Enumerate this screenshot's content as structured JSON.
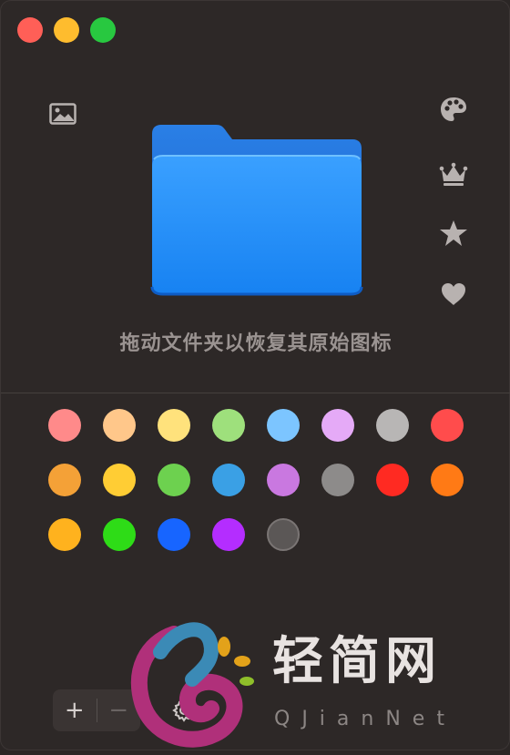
{
  "window": {
    "traffic_lights": [
      "close",
      "minimize",
      "maximize"
    ]
  },
  "icons": {
    "left": "image-icon",
    "right": [
      "palette-icon",
      "crown-icon",
      "star-icon",
      "heart-icon"
    ]
  },
  "folder": {
    "icon": "folder-icon",
    "color": "#1e8cf5"
  },
  "hint": "拖动文件夹以恢复其原始图标",
  "swatches": [
    "#ff8a8a",
    "#ffc78a",
    "#ffe27c",
    "#9ee07c",
    "#7cc5ff",
    "#e5aaf7",
    "#b8b6b5",
    "#ff4c4c",
    "#f4a137",
    "#ffcd34",
    "#6dd14f",
    "#3aa0e5",
    "#c978e0",
    "#8d8b8a",
    "#ff2a22",
    "#ff7a15",
    "#ffb21e",
    "#2edc17",
    "#1765ff",
    "#b42dff",
    "#5b5756"
  ],
  "toolbar": {
    "add_label": "+",
    "remove_label": "−"
  },
  "watermark": {
    "title": "轻简网",
    "subtitle": "QJianNet"
  }
}
